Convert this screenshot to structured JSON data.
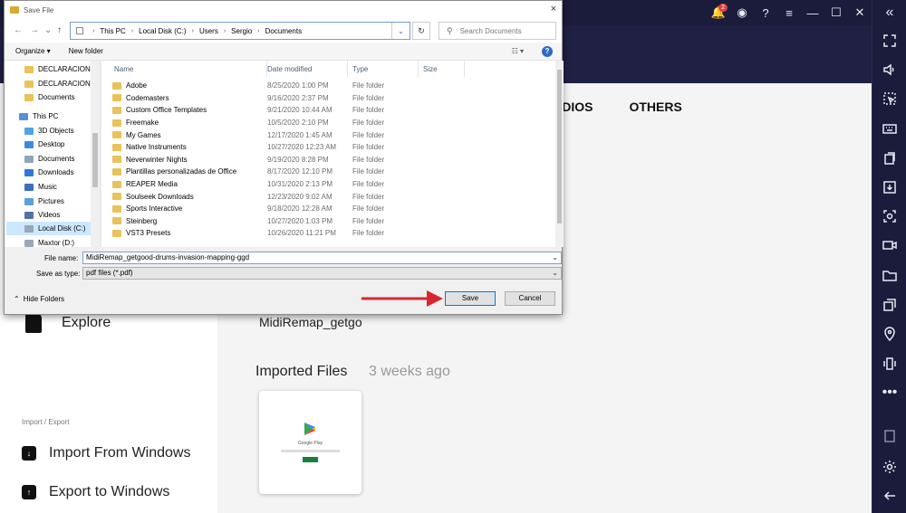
{
  "dialog": {
    "title": "Save File",
    "close_glyph": "×",
    "address": [
      "This PC",
      "Local Disk (C:)",
      "Users",
      "Sergio",
      "Documents"
    ],
    "search_placeholder": "Search Documents",
    "organize": "Organize ▾",
    "new_folder": "New folder",
    "help": "?",
    "tree": [
      {
        "label": "DECLARACIONE",
        "type": "folder"
      },
      {
        "label": "DECLARACIONE",
        "type": "folder"
      },
      {
        "label": "Documents",
        "type": "folder"
      },
      {
        "label": "This PC",
        "type": "pc"
      },
      {
        "label": "3D Objects",
        "type": "3d"
      },
      {
        "label": "Desktop",
        "type": "desktop"
      },
      {
        "label": "Documents",
        "type": "docs"
      },
      {
        "label": "Downloads",
        "type": "downloads"
      },
      {
        "label": "Music",
        "type": "music"
      },
      {
        "label": "Pictures",
        "type": "pictures"
      },
      {
        "label": "Videos",
        "type": "videos"
      },
      {
        "label": "Local Disk (C:)",
        "type": "disk",
        "selected": true
      },
      {
        "label": "Maxtor (D:)",
        "type": "disk"
      }
    ],
    "columns": {
      "name": "Name",
      "date": "Date modified",
      "type": "Type",
      "size": "Size"
    },
    "files": [
      {
        "name": "Adobe",
        "date": "8/25/2020 1:00 PM",
        "type": "File folder"
      },
      {
        "name": "Codemasters",
        "date": "9/16/2020 2:37 PM",
        "type": "File folder"
      },
      {
        "name": "Custom Office Templates",
        "date": "9/21/2020 10:44 AM",
        "type": "File folder"
      },
      {
        "name": "Freemake",
        "date": "10/5/2020 2:10 PM",
        "type": "File folder"
      },
      {
        "name": "My Games",
        "date": "12/17/2020 1:45 AM",
        "type": "File folder"
      },
      {
        "name": "Native Instruments",
        "date": "10/27/2020 12:23 AM",
        "type": "File folder"
      },
      {
        "name": "Neverwinter Nights",
        "date": "9/19/2020 8:28 PM",
        "type": "File folder"
      },
      {
        "name": "Plantillas personalizadas de Office",
        "date": "8/17/2020 12:10 PM",
        "type": "File folder"
      },
      {
        "name": "REAPER Media",
        "date": "10/31/2020 2:13 PM",
        "type": "File folder"
      },
      {
        "name": "Soulseek Downloads",
        "date": "12/23/2020 9:02 AM",
        "type": "File folder"
      },
      {
        "name": "Sports Interactive",
        "date": "9/18/2020 12:28 AM",
        "type": "File folder"
      },
      {
        "name": "Steinberg",
        "date": "10/27/2020 1:03 PM",
        "type": "File folder"
      },
      {
        "name": "VST3 Presets",
        "date": "10/26/2020 11:21 PM",
        "type": "File folder"
      }
    ],
    "file_name_label": "File name:",
    "file_name_value": "MidiRemap_getgood-drums-invasion-mapping-ggd",
    "save_type_label": "Save as type:",
    "save_type_value": "pdf files (*.pdf)",
    "hide_folders": "Hide Folders",
    "save_button": "Save",
    "cancel_button": "Cancel"
  },
  "app": {
    "tabs": [
      "AUDIOS",
      "OTHERS"
    ],
    "explore": "Explore",
    "midi_text": "MidiRemap_getgo",
    "imported_title": "Imported Files",
    "imported_ago": "3 weeks ago",
    "section_label": "Import / Export",
    "import_label": "Import From Windows",
    "export_label": "Export to Windows",
    "card_caption": "Google Play"
  },
  "topbar": {
    "notification_count": "2"
  },
  "colors": {
    "accent": "#2d6bc3",
    "arrow": "#d9262c",
    "bluestacks_bg": "#1b1c3b"
  }
}
